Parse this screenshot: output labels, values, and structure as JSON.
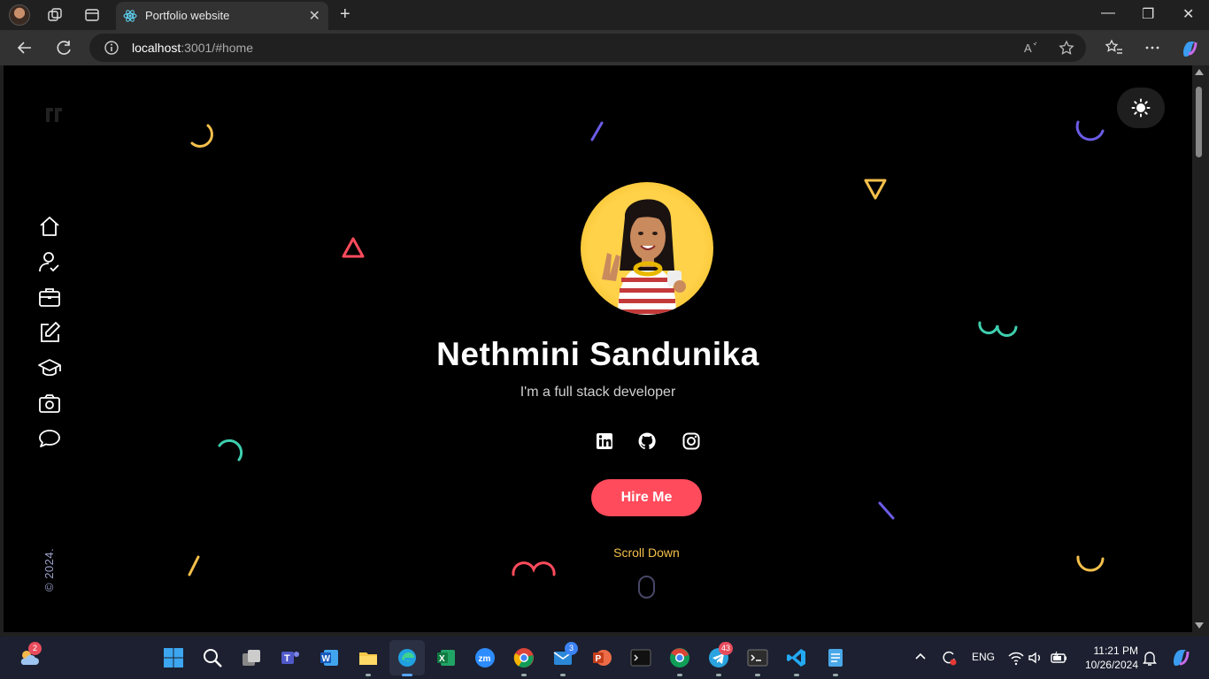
{
  "browser": {
    "tab_title": "Portfolio website",
    "url_host": "localhost",
    "url_rest": ":3001/#home",
    "new_tab": "+",
    "close_tab": "✕",
    "minimize": "—",
    "restore": "❐",
    "close_window": "✕"
  },
  "hero": {
    "name": "Nethmini Sandunika",
    "role": "I'm a full stack developer",
    "hire_label": "Hire Me",
    "scroll_label": "Scroll Down"
  },
  "sidebar": {
    "copyright": "© 2024.",
    "items": [
      "home",
      "about",
      "services",
      "blog",
      "education",
      "gallery",
      "contact"
    ]
  },
  "socials": [
    "linkedin",
    "github",
    "instagram"
  ],
  "colors": {
    "accent": "#ff4b5c",
    "yellow": "#f5c04b",
    "teal": "#3ecfae",
    "purple": "#6b5ce7",
    "background": "#000000"
  },
  "taskbar": {
    "weather_badge": "2",
    "mail_badge": "3",
    "telegram_badge": "43",
    "language": "ENG",
    "time": "11:21 PM",
    "date": "10/26/2024"
  }
}
